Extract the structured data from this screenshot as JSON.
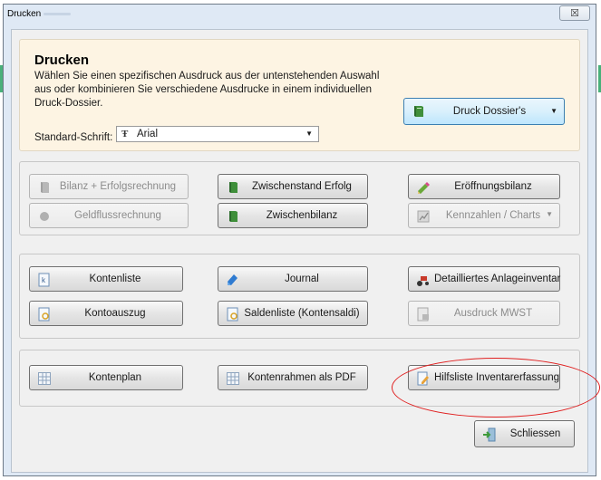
{
  "window": {
    "title": "Drucken",
    "close_label": "☒"
  },
  "header": {
    "title": "Drucken",
    "description": "Wählen Sie einen spezifischen Ausdruck aus der untenstehenden Auswahl aus oder kombinieren Sie verschiedene Ausdrucke in einem individuellen Druck-Dossier.",
    "dossier_button": "Druck Dossier's",
    "standard_font_label": "Standard-Schrift:",
    "standard_font_value": "Arial"
  },
  "group1": {
    "bilanz": "Bilanz + Erfolgsrechnung",
    "zwischenstand": "Zwischenstand Erfolg",
    "eroeffnung": "Eröffnungsbilanz",
    "geldfluss": "Geldflussrechnung",
    "zwischenbilanz": "Zwischenbilanz",
    "kennzahlen": "Kennzahlen / Charts"
  },
  "group2": {
    "kontenliste": "Kontenliste",
    "journal": "Journal",
    "anlageinventar": "Detailliertes Anlageinventar",
    "kontoauszug": "Kontoauszug",
    "saldenliste": "Saldenliste (Kontensaldi)",
    "mwst": "Ausdruck MWST"
  },
  "group3": {
    "kontenplan": "Kontenplan",
    "kontenrahmen": "Kontenrahmen als PDF",
    "hilfsliste": "Hilfsliste Inventarerfassung"
  },
  "footer": {
    "close_button": "Schliessen"
  },
  "colors": {
    "annotation": "#e02020",
    "header_bg": "#fdf4e3",
    "accent_border": "#3c7fb1"
  }
}
